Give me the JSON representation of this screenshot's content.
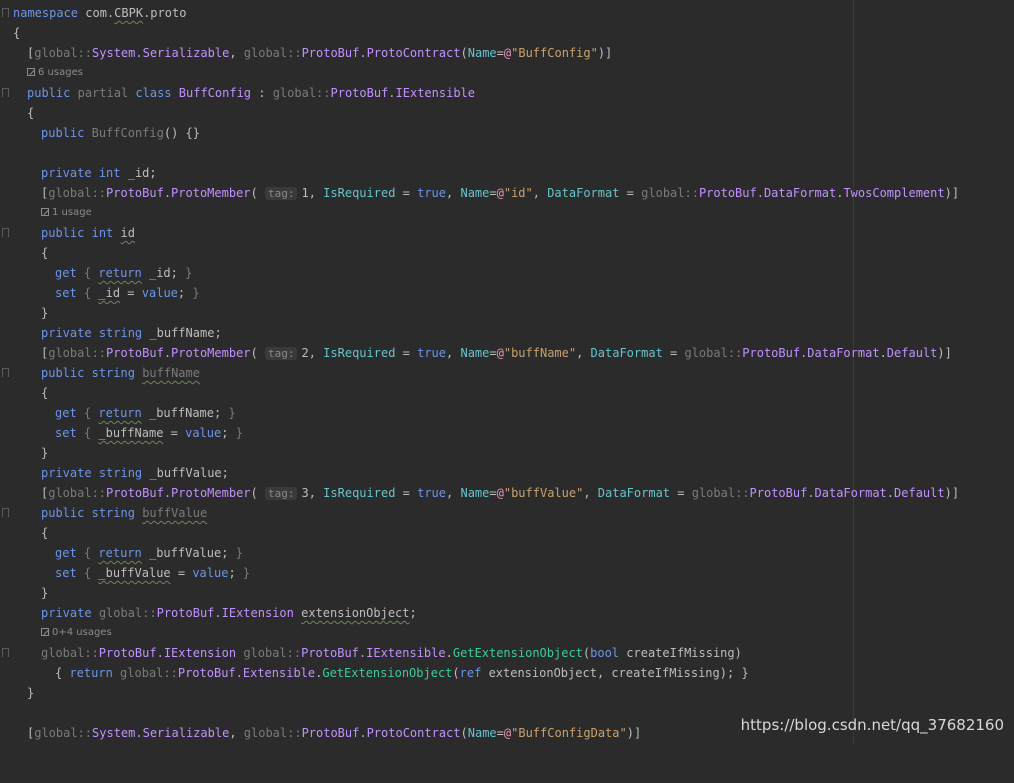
{
  "editor": {
    "language": "csharp",
    "colors": {
      "background": "#2b2b2b",
      "keyword": "#6c95eb",
      "type": "#c191ff",
      "global": "#7a7a7a",
      "string": "#c9a26d",
      "string_prefix": "#ed94c0",
      "parameter": "#66c3cc",
      "method": "#39cc9b",
      "default_text": "#bdbdbd"
    },
    "usage_hints": {
      "buffconfig": "6 usages",
      "id": "1 usage",
      "extension": "0+4 usages"
    },
    "param_hint": "tag:",
    "lines": [
      "namespace com.CBPK.proto",
      "{",
      "[global::System.Serializable, global::ProtoBuf.ProtoContract(Name=@\"BuffConfig\")]",
      "",
      "public partial class BuffConfig : global::ProtoBuf.IExtensible",
      "{",
      "public BuffConfig() {}",
      "",
      "private int _id;",
      "[global::ProtoBuf.ProtoMember( 1, IsRequired = true, Name=@\"id\", DataFormat = global::ProtoBuf.DataFormat.TwosComplement)]",
      "",
      "public int id",
      "{",
      "get { return _id; }",
      "set { _id = value; }",
      "}",
      "private string _buffName;",
      "[global::ProtoBuf.ProtoMember( 2, IsRequired = true, Name=@\"buffName\", DataFormat = global::ProtoBuf.DataFormat.Default)]",
      "public string buffName",
      "{",
      "get { return _buffName; }",
      "set { _buffName = value; }",
      "}",
      "private string _buffValue;",
      "[global::ProtoBuf.ProtoMember( 3, IsRequired = true, Name=@\"buffValue\", DataFormat = global::ProtoBuf.DataFormat.Default)]",
      "public string buffValue",
      "{",
      "get { return _buffValue; }",
      "set { _buffValue = value; }",
      "}",
      "private global::ProtoBuf.IExtension extensionObject;",
      "",
      "global::ProtoBuf.IExtension global::ProtoBuf.IExtensible.GetExtensionObject(bool createIfMissing)",
      "{ return global::ProtoBuf.Extensible.GetExtensionObject(ref extensionObject, createIfMissing); }",
      "}",
      "",
      "[global::System.Serializable, global::ProtoBuf.ProtoContract(Name=@\"BuffConfigData\")]"
    ]
  },
  "watermark": "https://blog.csdn.net/qq_37682160"
}
